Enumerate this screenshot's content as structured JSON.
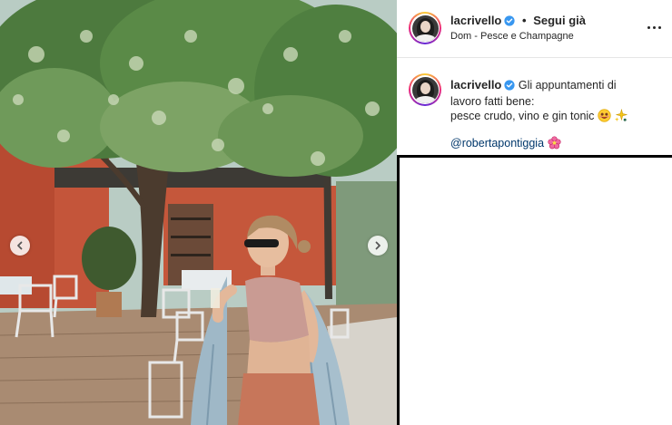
{
  "post": {
    "username": "lacrivello",
    "separator": "•",
    "follow_label": "Segui già",
    "location": "Dom - Pesce e Champagne"
  },
  "caption": {
    "username": "lacrivello",
    "line1": "Gli appuntamenti di",
    "line2": "lavoro fatti bene:",
    "line3": "pesce crudo, vino e gin tonic",
    "mention": "@robertapontiggia"
  },
  "icons": {
    "verified": "verified-badge-icon",
    "more": "more-options-icon",
    "prev": "chevron-left-icon",
    "next": "chevron-right-icon",
    "emoji_face": "smiling-face-icon",
    "emoji_sparkles": "sparkles-icon",
    "emoji_flower": "hibiscus-flower-icon"
  },
  "colors": {
    "verified_blue": "#3897f0",
    "mention_blue": "#00376b",
    "text": "#262626"
  }
}
